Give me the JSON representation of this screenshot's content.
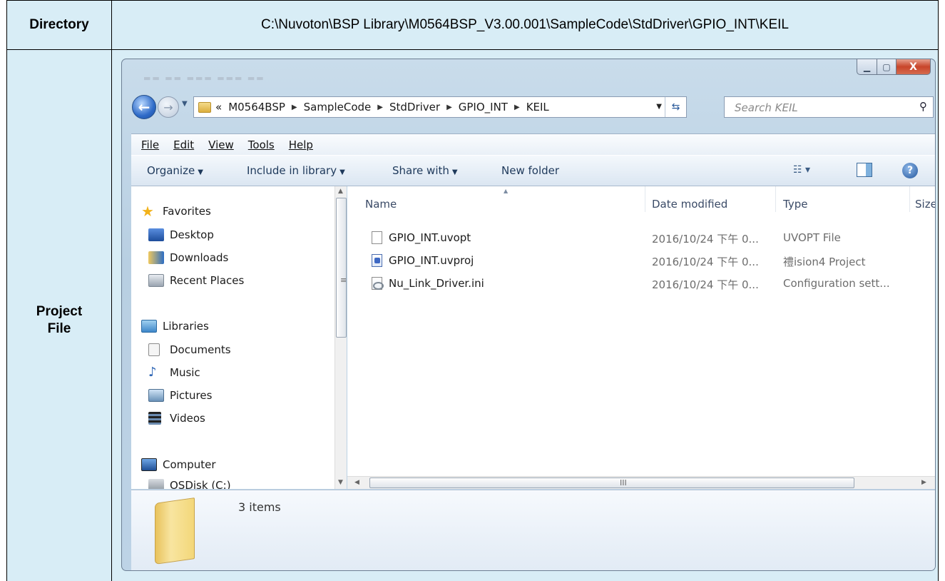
{
  "table": {
    "directory_header": "Directory",
    "directory_value": "C:\\Nuvoton\\BSP Library\\M0564BSP_V3.00.001\\SampleCode\\StdDriver\\GPIO_INT\\KEIL",
    "project_header_line1": "Project",
    "project_header_line2": "File"
  },
  "explorer": {
    "caption_buttons": {
      "minimize": "▁",
      "maximize": "▢",
      "close": "X"
    },
    "breadcrumb": {
      "overflow": "«",
      "segments": [
        "M0564BSP",
        "SampleCode",
        "StdDriver",
        "GPIO_INT",
        "KEIL"
      ]
    },
    "search_placeholder": "Search KEIL",
    "menu": [
      "File",
      "Edit",
      "View",
      "Tools",
      "Help"
    ],
    "toolbar": {
      "organize": "Organize",
      "include": "Include in library",
      "share": "Share with",
      "new_folder": "New folder"
    },
    "nav": {
      "favorites": "Favorites",
      "desktop": "Desktop",
      "downloads": "Downloads",
      "recent": "Recent Places",
      "libraries": "Libraries",
      "documents": "Documents",
      "music": "Music",
      "pictures": "Pictures",
      "videos": "Videos",
      "computer": "Computer",
      "osdisk": "OSDisk (C:)"
    },
    "columns": {
      "name": "Name",
      "date": "Date modified",
      "type": "Type",
      "size": "Size"
    },
    "files": [
      {
        "name": "GPIO_INT.uvopt",
        "date": "2016/10/24 下午 0...",
        "type": "UVOPT File",
        "icon": "document-icon"
      },
      {
        "name": "GPIO_INT.uvproj",
        "date": "2016/10/24 下午 0...",
        "type": "禮ision4 Project",
        "icon": "uvision-project-icon"
      },
      {
        "name": "Nu_Link_Driver.ini",
        "date": "2016/10/24 下午 0...",
        "type": "Configuration sett...",
        "icon": "settings-file-icon"
      }
    ],
    "status": {
      "item_count": "3 items"
    }
  }
}
